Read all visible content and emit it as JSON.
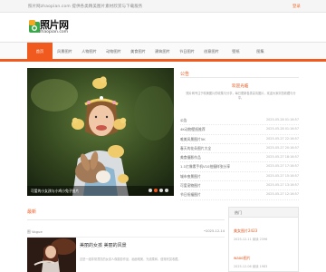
{
  "topbar": {
    "title": "照片网zhaopian.com 提供各类精美图片素材欣赏与下载服务",
    "right_link": "登录"
  },
  "logo": {
    "name": "照片网",
    "domain": "zhaopian.com"
  },
  "nav": {
    "items": [
      "首页",
      "风景图片",
      "人物图片",
      "动物图片",
      "美食图片",
      "建筑图片",
      "节日图片",
      "创意图片",
      "壁纸",
      "图集"
    ]
  },
  "hero": {
    "caption": "可爱的小女孩与小鸡小兔子图片",
    "dot_count": 4,
    "active_dot": 1
  },
  "notice": {
    "section_title": "公告",
    "title": "欢迎光临",
    "text": "照片网专注于精美图片的收集与分享，每日更新各类高清图片，欢迎大家浏览收藏与分享。"
  },
  "news": [
    {
      "title": "公告",
      "date": "2025-05-28 01:16:57"
    },
    {
      "title": "4K动物壁纸推荐",
      "date": "2025-05-28 01:16:57"
    },
    {
      "title": "唯美风景图片5K",
      "date": "2025-05-27 22:16:57"
    },
    {
      "title": "春天的花朵图片大全",
      "date": "2025-05-27 20:16:57"
    },
    {
      "title": "美食摄影作品",
      "date": "2025-05-27 18:16:57"
    },
    {
      "title": "1.1亿像素手机V10拍摄样张分享",
      "date": "2025-05-27 17:16:57"
    },
    {
      "title": "城市夜景图片",
      "date": "2025-05-27 15:16:57"
    },
    {
      "title": "可爱宠物图片",
      "date": "2025-05-27 13:16:57"
    },
    {
      "title": "节日祝福图片",
      "date": "2025-05-27 12:16:57"
    }
  ],
  "latest": {
    "section_title": "最新",
    "author": "图 Vogue",
    "date": "•2025-12-14",
    "post_title": "美丽的女孩 美丽的风景",
    "excerpt": "这是一组非常漂亮的女孩人像摄影作品，画面唯美，光线柔和，值得欣赏收藏。"
  },
  "sidebar": {
    "header": "热门",
    "entries": [
      {
        "title": "美女图片2423",
        "meta": "2025-12-11 阅读 2396"
      },
      {
        "title": "waoo图片",
        "meta": "2025-12-06 阅读 1983"
      }
    ]
  },
  "colors": {
    "accent": "#f05a1f",
    "link": "#e0561c"
  }
}
